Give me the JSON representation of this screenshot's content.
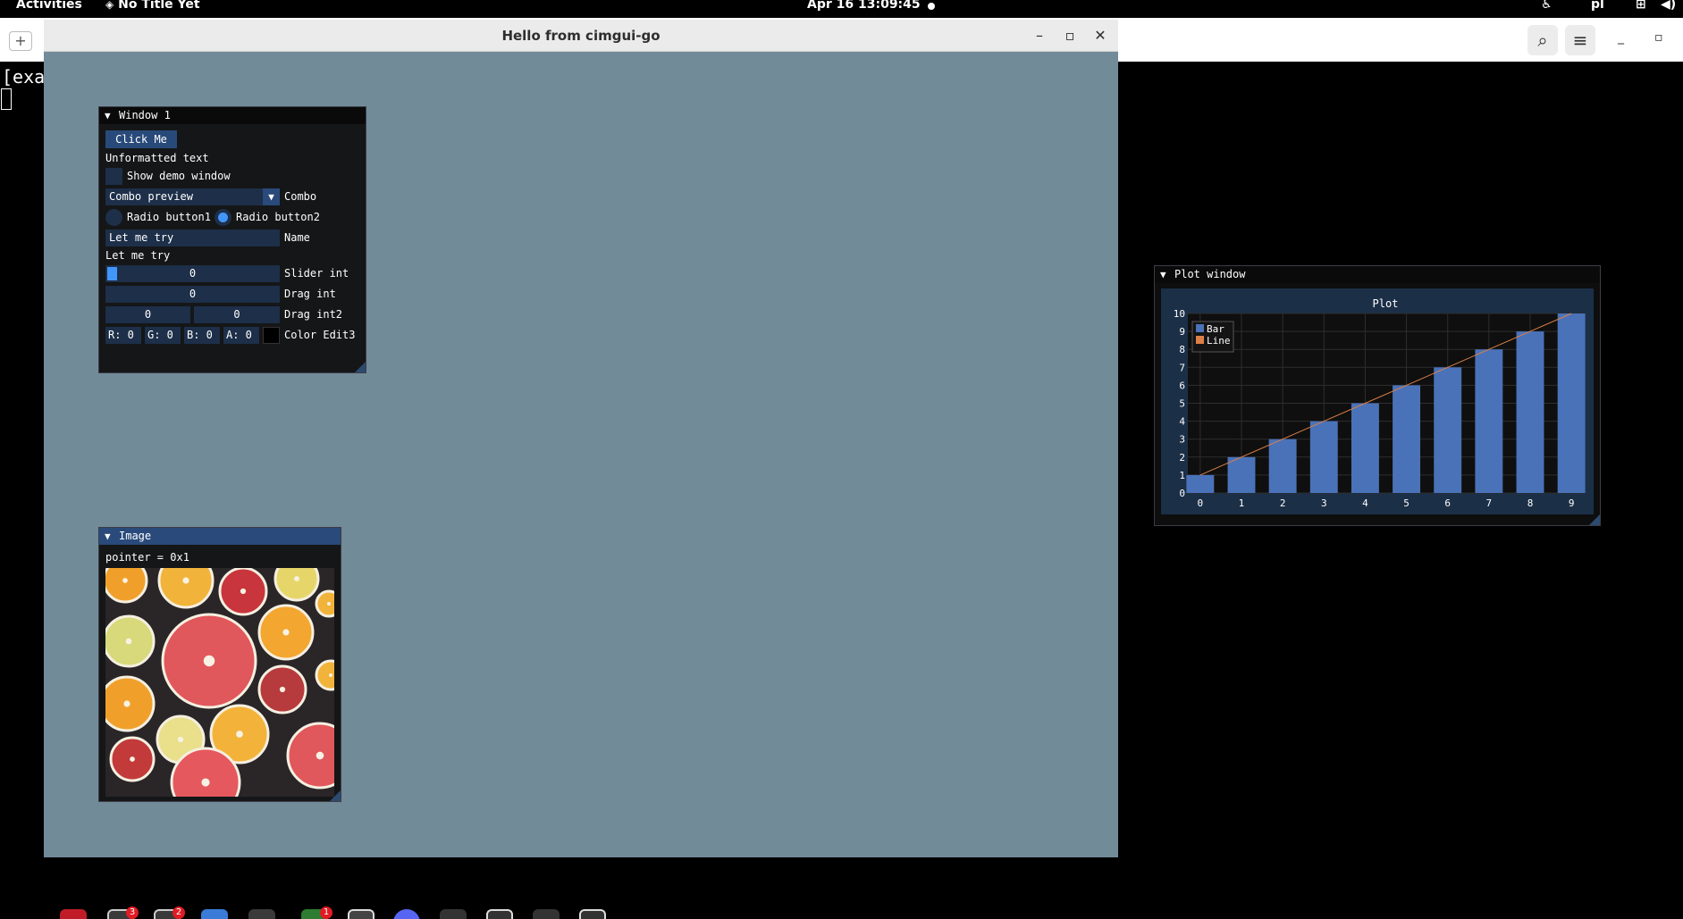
{
  "topbar": {
    "activities": "Activities",
    "app_name": "No Title Yet",
    "clock": "Apr 16  13:09:45",
    "lang": "pl",
    "icons": [
      "accessibility-icon",
      "network-icon",
      "volume-icon"
    ]
  },
  "terminal": {
    "buffer_text": "[exa"
  },
  "app_window": {
    "title": "Hello from cimgui-go"
  },
  "window1": {
    "title": "Window 1",
    "click_me": "Click Me",
    "unformatted": "Unformatted text",
    "show_demo": "Show demo window",
    "combo_value": "Combo preview",
    "combo_label": "Combo",
    "radio1": "Radio button1",
    "radio2": "Radio button2",
    "name_value": "Let me try",
    "name_label": "Name",
    "echo_text": "Let me try",
    "slider_value": "0",
    "slider_label": "Slider int",
    "drag_value": "0",
    "drag_label": "Drag int",
    "drag2_a": "0",
    "drag2_b": "0",
    "drag2_label": "Drag int2",
    "color_r": "R:  0",
    "color_g": "G:  0",
    "color_b": "B:  0",
    "color_a": "A:  0",
    "color_label": "Color Edit3"
  },
  "image_window": {
    "title": "Image",
    "pointer_text": "pointer = 0x1"
  },
  "plot_window": {
    "title": "Plot window"
  },
  "chart_data": {
    "type": "bar",
    "title": "Plot",
    "xlabel": "",
    "ylabel": "",
    "x": [
      0,
      1,
      2,
      3,
      4,
      5,
      6,
      7,
      8,
      9
    ],
    "xticks": [
      "0",
      "1",
      "2",
      "3",
      "4",
      "5",
      "6",
      "7",
      "8",
      "9"
    ],
    "yticks": [
      "0",
      "1",
      "2",
      "3",
      "4",
      "5",
      "6",
      "7",
      "8",
      "9",
      "10"
    ],
    "xlim": [
      -0.3,
      9.3
    ],
    "ylim": [
      0,
      10
    ],
    "grid": true,
    "legend": "top-left",
    "series": [
      {
        "name": "Bar",
        "type": "bar",
        "color": "#4a72b8",
        "values": [
          1,
          2,
          3,
          4,
          5,
          6,
          7,
          8,
          9,
          10
        ]
      },
      {
        "name": "Line",
        "type": "line",
        "color": "#dd8047",
        "values": [
          1,
          2,
          3,
          4,
          5,
          6,
          7,
          8,
          9,
          10
        ]
      }
    ]
  },
  "colors": {
    "app_background": "#728b99",
    "imgui_frame": "#1d2f49",
    "imgui_accent": "#4296fa"
  }
}
